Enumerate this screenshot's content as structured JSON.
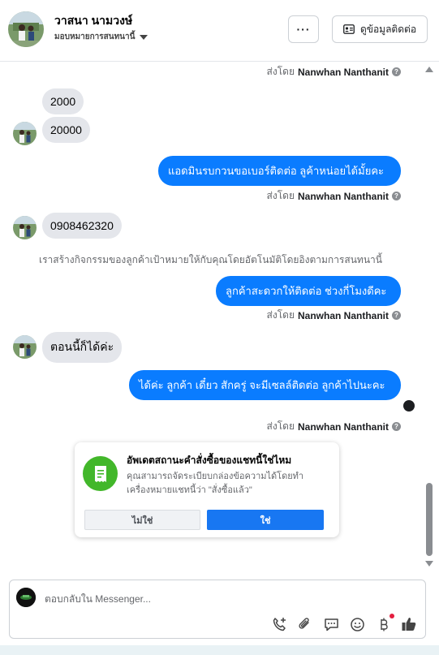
{
  "header": {
    "contact_name": "วาสนา นามวงษ์",
    "assign_label": "มอบหมายการสนทนานี้",
    "more_label": "···",
    "contact_info_label": "ดูข้อมูลติดต่อ"
  },
  "messages": {
    "sent_prefix": "ส่งโดย",
    "sender_name": "Nanwhan Nanthanit",
    "in_1": "2000",
    "in_2": "20000",
    "out_1": "แอดมินรบกวนขอเบอร์ติดต่อ ลูค้าหน่อยได้มั้ยคะ",
    "in_3": "0908462320",
    "system_note": "เราสร้างกิจกรรมของลูกค้าเป้าหมายให้กับคุณโดยอัตโนมัติโดยอิงตามการสนทนานี้",
    "out_2": "ลูกค้าสะดวกให้ติดต่อ ช่วงกี่โมงดีคะ",
    "in_4": "ตอนนี้ก็ได้ค่ะ",
    "out_3": "ได้ค่ะ ลูกค้า เดี๋ยว สักครู่ จะมีเซลล์ติดต่อ ลูกค้าไปนะคะ"
  },
  "order_card": {
    "title": "อัพเดตสถานะคำสั่งซื้อของแชทนี้ใช่ไหม",
    "description": "คุณสามารถจัดระเบียบกล่องข้อความได้โดยทำเครื่องหมายแชทนี้ว่า \"สั่งซื้อแล้ว\"",
    "no_label": "ไม่ใช่",
    "yes_label": "ใช่"
  },
  "composer": {
    "placeholder": "ตอบกลับใน Messenger...",
    "icons": [
      "phone-add-icon",
      "attachment-icon",
      "saved-reply-icon",
      "emoji-icon",
      "payment-icon",
      "like-icon"
    ]
  },
  "colors": {
    "outgoing_bubble": "#0a7cff",
    "incoming_bubble": "#e4e6eb",
    "order_icon_bg": "#42b72a",
    "yes_button": "#1877f2"
  }
}
